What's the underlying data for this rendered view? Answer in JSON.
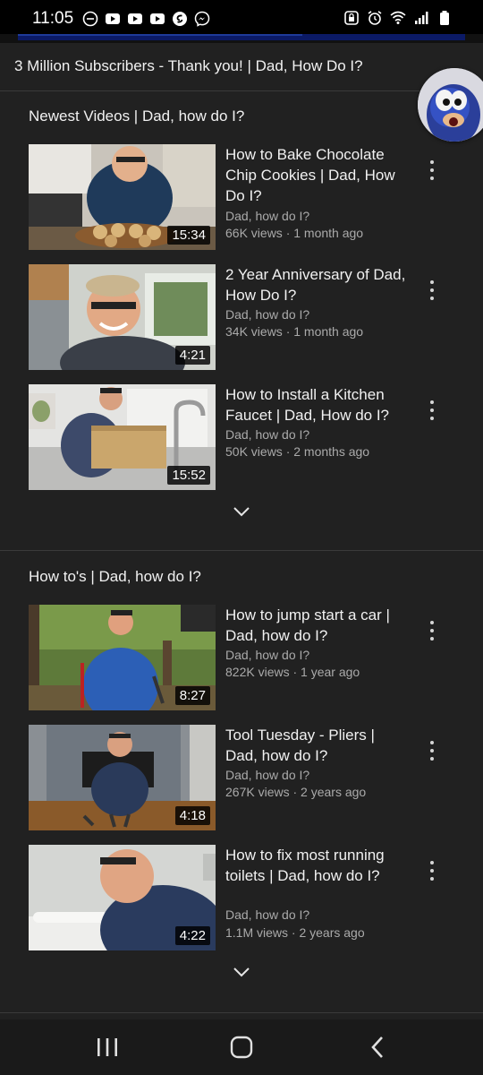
{
  "status_bar": {
    "time": "11:05",
    "left_icons": [
      "do-not-disturb-icon",
      "youtube-icon",
      "youtube-icon",
      "youtube-icon",
      "shazam-icon",
      "messenger-icon"
    ],
    "right_icons": [
      "lock-icon",
      "alarm-icon",
      "wifi-icon",
      "signal-icon",
      "battery-icon"
    ]
  },
  "announcement": "3 Million Subscribers - Thank you! | Dad, How Do I?",
  "sections": [
    {
      "title": "Newest Videos | Dad, how do I?",
      "videos": [
        {
          "title": "How to Bake Chocolate Chip Cookies | Dad, How Do I?",
          "channel": "Dad, how do I?",
          "stats": "66K views · 1 month ago",
          "duration": "15:34"
        },
        {
          "title": "2 Year Anniversary of Dad, How Do I?",
          "channel": "Dad, how do I?",
          "stats": "34K views · 1 month ago",
          "duration": "4:21"
        },
        {
          "title": "How to Install a Kitchen Faucet | Dad, How do I?",
          "channel": "Dad, how do I?",
          "stats": "50K views · 2 months ago",
          "duration": "15:52"
        }
      ]
    },
    {
      "title": "How to's | Dad, how do I?",
      "videos": [
        {
          "title": "How to jump start a car | Dad, how do I?",
          "channel": "Dad, how do I?",
          "stats": "822K views · 1 year ago",
          "duration": "8:27"
        },
        {
          "title": "Tool Tuesday - Pliers | Dad, how do I?",
          "channel": "Dad, how do I?",
          "stats": "267K views · 2 years ago",
          "duration": "4:18"
        },
        {
          "title": "How to fix most running toilets | Dad, how do I?",
          "channel": "Dad, how do I?",
          "stats": "1.1M views · 2 years ago",
          "duration": "4:22"
        }
      ]
    }
  ],
  "colors": {
    "background": "#212121",
    "text": "#f1f1f1",
    "meta": "#aaaaaa",
    "divider": "#3a3a3a"
  },
  "nav_icons": [
    "recent-apps-icon",
    "home-icon",
    "back-icon"
  ]
}
